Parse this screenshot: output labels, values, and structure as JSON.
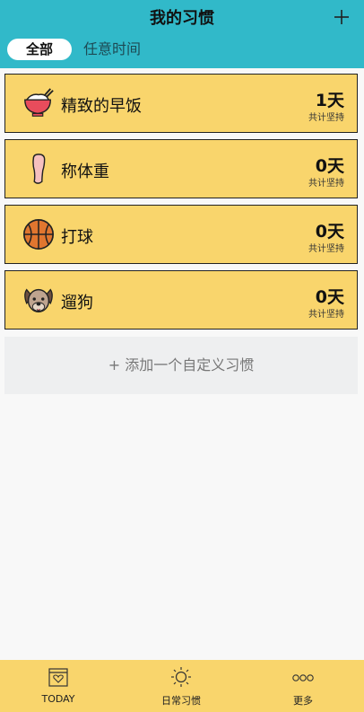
{
  "header": {
    "title": "我的习惯",
    "add_icon": "plus-icon"
  },
  "tabs": [
    {
      "label": "全部",
      "selected": true
    },
    {
      "label": "任意时间",
      "selected": false
    }
  ],
  "habits": [
    {
      "name": "精致的早饭",
      "days": "1天",
      "sub": "共计坚持",
      "icon": "rice-bowl-icon"
    },
    {
      "name": "称体重",
      "days": "0天",
      "sub": "共计坚持",
      "icon": "foot-icon"
    },
    {
      "name": "打球",
      "days": "0天",
      "sub": "共计坚持",
      "icon": "basketball-icon"
    },
    {
      "name": "遛狗",
      "days": "0天",
      "sub": "共计坚持",
      "icon": "dog-icon"
    }
  ],
  "add_custom": "+ 添加一个自定义习惯",
  "bottom_nav": [
    {
      "label": "TODAY",
      "icon": "today-icon"
    },
    {
      "label": "日常习惯",
      "icon": "sun-icon"
    },
    {
      "label": "更多",
      "icon": "more-icon"
    }
  ],
  "colors": {
    "header": "#31b9c9",
    "card": "#f9d56c",
    "bottom_bar": "#f9d56c"
  }
}
